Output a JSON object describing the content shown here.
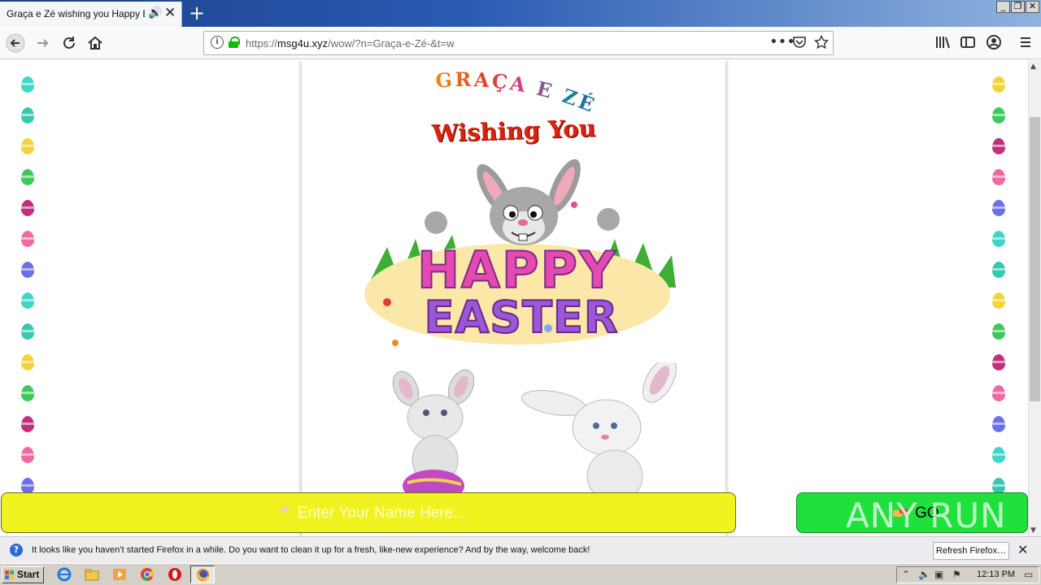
{
  "browser": {
    "tab_title": "Graça e Zé wishing you Happy Easter",
    "url_prefix": "https://",
    "url_host": "msg4u.xyz",
    "url_path": "/wow/?n=Graça-e-Zé-&t=w",
    "window_buttons": [
      "_",
      "❐",
      "✕"
    ]
  },
  "card": {
    "names_text": "GRAÇA E ZÉ",
    "wishing_text": "Wishing You",
    "banner_top": "HAPPY",
    "banner_bottom": "EASTER"
  },
  "form": {
    "name_placeholder": "Enter Your Name Here...",
    "go_label": "GO"
  },
  "watermark": "ANY RUN",
  "notification": {
    "message": "It looks like you haven’t started Firefox in a while. Do you want to clean it up for a fresh, like-new experience? And by the way, welcome back!",
    "refresh_label": "Refresh Firefox…"
  },
  "taskbar": {
    "start_label": "Start",
    "clock": "12:13 PM"
  },
  "egg_colors": {
    "left": [
      "#3fd6c8",
      "#37c9b0",
      "#f2d33a",
      "#3fc95a",
      "#c1307e",
      "#ef6aa0",
      "#6b6fe8",
      "#3fd6c8",
      "#37c9b0",
      "#f2d33a",
      "#3fc95a",
      "#c1307e",
      "#ef6aa0",
      "#6b6fe8"
    ],
    "right": [
      "#f2d33a",
      "#3fc95a",
      "#c1307e",
      "#ef6aa0",
      "#6b6fe8",
      "#3fd6c8",
      "#37c9b0",
      "#f2d33a",
      "#3fc95a",
      "#c1307e",
      "#ef6aa0",
      "#6b6fe8",
      "#3fd6c8",
      "#37c9b0"
    ]
  }
}
